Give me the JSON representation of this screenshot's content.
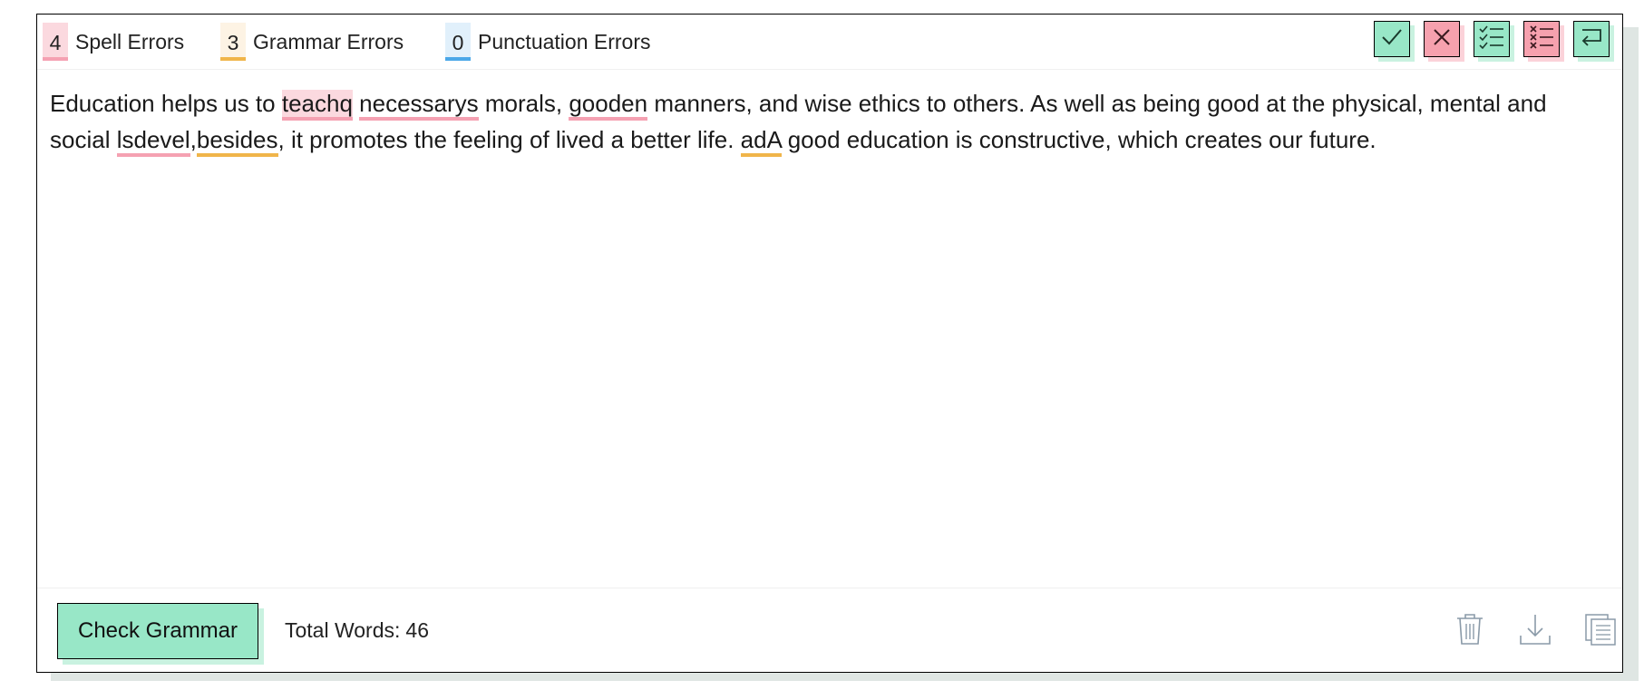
{
  "counters": {
    "spell": {
      "count": "4",
      "label": "Spell Errors",
      "color": "#f5a1b2"
    },
    "grammar": {
      "count": "3",
      "label": "Grammar Errors",
      "color": "#f0b54a"
    },
    "punctuation": {
      "count": "0",
      "label": "Punctuation Errors",
      "color": "#4aa7e8"
    }
  },
  "toolbar": {
    "accept_icon": "check-icon",
    "reject_icon": "x-icon",
    "accept_all_icon": "checklist-icon",
    "reject_all_icon": "x-list-icon",
    "return_icon": "return-icon"
  },
  "text": {
    "s1": "Education helps us to ",
    "e1": "teachq",
    "s2": " ",
    "e2": "necessarys",
    "s3": " morals, ",
    "e3": "gooden",
    "s4": " manners, and wise ethics to others. As well as being good at the physical, mental and social ",
    "e4": "lsdevel",
    "s5": ",",
    "e5": "besides",
    "s6": ", it promotes the feeling of lived a better life. ",
    "e6": "adA",
    "s7": " good education is constructive, which creates our future."
  },
  "footer": {
    "check_label": "Check Grammar",
    "words_label": "Total Words:",
    "words_value": "46",
    "delete_icon": "trash-icon",
    "download_icon": "download-icon",
    "copy_icon": "copy-icon"
  },
  "colors": {
    "accent_green": "#98e7c7",
    "accent_red": "#f6a1ae",
    "spell_highlight": "#fbd9df"
  }
}
